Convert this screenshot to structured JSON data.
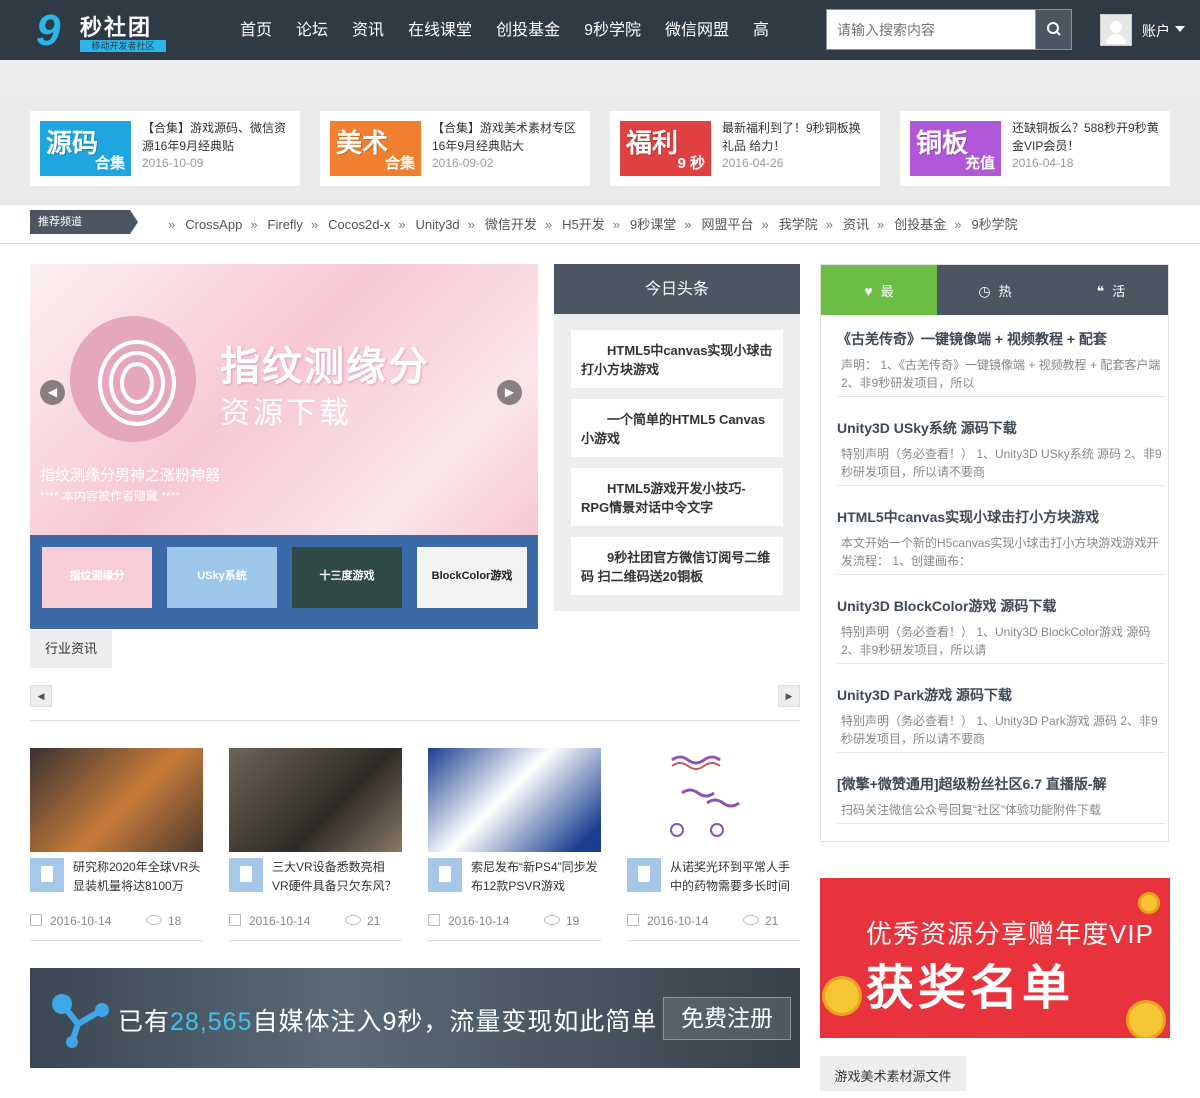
{
  "header": {
    "logo_text": "秒社团",
    "logo_sub": "移动开发者社区",
    "nav": [
      "首页",
      "论坛",
      "资讯",
      "在线课堂",
      "创投基金",
      "9秒学院",
      "微信网盟",
      "高"
    ],
    "search_placeholder": "请输入搜索内容",
    "account_label": "账户"
  },
  "promos": [
    {
      "thumb_big": "源码",
      "thumb_small": "合集",
      "title": "【合集】游戏源码、微信资源16年9月经典贴",
      "date": "2016-10-09",
      "color": "#1fa6e0"
    },
    {
      "thumb_big": "美术",
      "thumb_small": "合集",
      "title": "【合集】游戏美术素材专区16年9月经典贴大",
      "date": "2016-09-02",
      "color": "#f08030"
    },
    {
      "thumb_big": "福利",
      "thumb_small": "9 秒",
      "title": "最新福利到了！9秒铜板换礼品 给力！",
      "date": "2016-04-26",
      "color": "#e04040"
    },
    {
      "thumb_big": "铜板",
      "thumb_small": "充值",
      "title": "还缺铜板么？588秒开9秒黄金VIP会员！",
      "date": "2016-04-18",
      "color": "#b058d8"
    }
  ],
  "channel": {
    "tag": "推荐频道",
    "links": [
      "CrossApp",
      "Firefly",
      "Cocos2d-x",
      "Unity3d",
      "微信开发",
      "H5开发",
      "9秒课堂",
      "网盟平台",
      "我学院",
      "资讯",
      "创投基金",
      "9秒学院"
    ]
  },
  "banner": {
    "title": "指纹测缘分",
    "subtitle": "资源下载",
    "caption": "指纹测缘分男神之涨粉神器",
    "caption2": "**** 本内容被作者隐藏 ****",
    "thumbs": [
      "指纹测缘分",
      "USky系统",
      "十三度游戏",
      "BlockColor游戏"
    ],
    "tab": "行业资讯"
  },
  "headlines": {
    "title": "今日头条",
    "items": [
      "HTML5中canvas实现小球击打小方块游戏",
      "一个简单的HTML5 Canvas小游戏",
      "HTML5游戏开发小技巧-RPG情景对话中令文字",
      "9秒社团官方微信订阅号二维码 扫二维码送20铜板"
    ]
  },
  "news": [
    {
      "title": "研究称2020年全球VR头显装机量将达8100万",
      "date": "2016-10-14",
      "views": "18"
    },
    {
      "title": "三大VR设备悉数亮相 VR硬件具备只欠东风？",
      "date": "2016-10-14",
      "views": "21"
    },
    {
      "title": "索尼发布“新PS4”同步发布12款PSVR游戏",
      "date": "2016-10-14",
      "views": "19"
    },
    {
      "title": "从诺奖光环到平常人手中的药物需要多长时间",
      "date": "2016-10-14",
      "views": "21"
    }
  ],
  "ad_bottom": {
    "prefix": "已有",
    "count": "28,565",
    "suffix": "自媒体注入9秒，流量变现如此简单",
    "button": "免费注册"
  },
  "sidebar": {
    "tabs": [
      "最",
      "热",
      "活"
    ],
    "items": [
      {
        "title": "《古羌传奇》一键镜像端 + 视频教程 + 配套",
        "desc": "声明： 1、《古羌传奇》一键镜像端 + 视频教程 + 配套客户端 2、非9秒研发项目，所以"
      },
      {
        "title": "Unity3D USky系统 源码下载",
        "desc": "特别声明（务必查看！） 1、Unity3D USky系统 源码 2、非9秒研发项目，所以请不要商"
      },
      {
        "title": "HTML5中canvas实现小球击打小方块游戏",
        "desc": "本文开始一个新的H5canvas实现小球击打小方块游戏游戏开发流程： 1、创建画布："
      },
      {
        "title": "Unity3D BlockColor游戏 源码下载",
        "desc": "特别声明（务必查看！） 1、Unity3D BlockColor游戏 源码 2、非9秒研发项目，所以请"
      },
      {
        "title": "Unity3D Park游戏 源码下载",
        "desc": "特别声明（务必查看！） 1、Unity3D Park游戏 源码 2、非9秒研发项目，所以请不要商"
      },
      {
        "title": "[微擎+微赞通用]超级粉丝社区6.7 直播版-解",
        "desc": "扫码关注微信公众号回复“社区”体验功能附件下载"
      }
    ]
  },
  "ad_right": {
    "line1": "优秀资源分享赠年度VIP",
    "line2": "获奖名单"
  },
  "side_tab": "游戏美术素材源文件",
  "colors": {
    "topbar": "#2f3a45",
    "accent_green": "#6cbd45",
    "accent_blue": "#2ab6ea"
  }
}
